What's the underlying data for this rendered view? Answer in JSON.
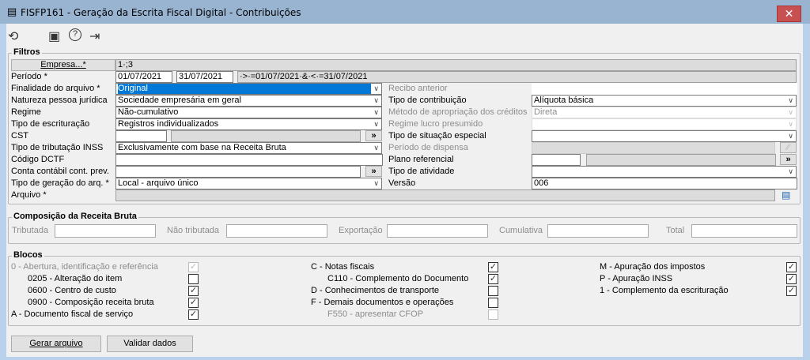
{
  "window": {
    "title": "FISFP161 - Geração da Escrita Fiscal Digital - Contribuições",
    "close": "✕"
  },
  "toolbar": {
    "undo": "⟲",
    "calendar": "▣",
    "help": "?",
    "exit": "⇥"
  },
  "filtros": {
    "legend": "Filtros",
    "empresa_button": "Empresa...*",
    "empresa_value": "1·;3",
    "periodo_label": "Período *",
    "periodo_start": "01/07/2021",
    "periodo_end": "31/07/2021",
    "periodo_expr": "·>·=01/07/2021·&·<·=31/07/2021",
    "finalidade_label": "Finalidade do arquivo *",
    "finalidade_value": "Original",
    "natureza_label": "Natureza pessoa jurídica",
    "natureza_value": "Sociedade empresária em geral",
    "regime_label": "Regime",
    "regime_value": "Não-cumulativo",
    "escrituracao_label": "Tipo de escrituração",
    "escrituracao_value": "Registros individualizados",
    "cst_label": "CST",
    "inss_label": "Tipo de tributação INSS",
    "inss_value": "Exclusivamente com base na Receita Bruta",
    "dctf_label": "Código DCTF",
    "conta_label": "Conta contábil cont. prev.",
    "geracao_label": "Tipo de geração do arq. *",
    "geracao_value": "Local - arquivo único",
    "arquivo_label": "Arquivo *",
    "recibo_label": "Recibo anterior",
    "contribuicao_label": "Tipo de contribuição",
    "contribuicao_value": "Alíquota básica",
    "metodo_label": "Método de apropriação dos créditos",
    "metodo_value": "Direta",
    "lucro_label": "Regime lucro presumido",
    "situacao_label": "Tipo de situação especial",
    "dispensa_label": "Período de dispensa",
    "plano_label": "Plano referencial",
    "atividade_label": "Tipo de atividade",
    "versao_label": "Versão",
    "versao_value": "006",
    "lookup": "»"
  },
  "composicao": {
    "legend": "Composição da Receita Bruta",
    "tributada": "Tributada",
    "nao_tributada": "Não tributada",
    "exportacao": "Exportação",
    "cumulativa": "Cumulativa",
    "total": "Total"
  },
  "blocos": {
    "legend": "Blocos",
    "items": [
      {
        "label": "0 - Abertura, identificação e referência",
        "checked": true,
        "disabled": true
      },
      {
        "label": "0205 - Alteração do item",
        "checked": false
      },
      {
        "label": "0600 - Centro de custo",
        "checked": true
      },
      {
        "label": "0900 - Composição receita bruta",
        "checked": true
      },
      {
        "label": "A - Documento fiscal de serviço",
        "checked": true
      },
      {
        "label": "C - Notas fiscais",
        "checked": true
      },
      {
        "label": "C110 - Complemento do Documento",
        "checked": true
      },
      {
        "label": "D - Conhecimentos de transporte",
        "checked": false
      },
      {
        "label": "F - Demais documentos e operações",
        "checked": false
      },
      {
        "label": "F550 - apresentar CFOP",
        "checked": false,
        "disabled": true
      },
      {
        "label": "M - Apuração dos impostos",
        "checked": true
      },
      {
        "label": "P - Apuração INSS",
        "checked": true
      },
      {
        "label": "1 - Complemento da escrituração",
        "checked": true
      }
    ]
  },
  "buttons": {
    "gerar": "Gerar arquivo",
    "validar": "Validar dados"
  }
}
